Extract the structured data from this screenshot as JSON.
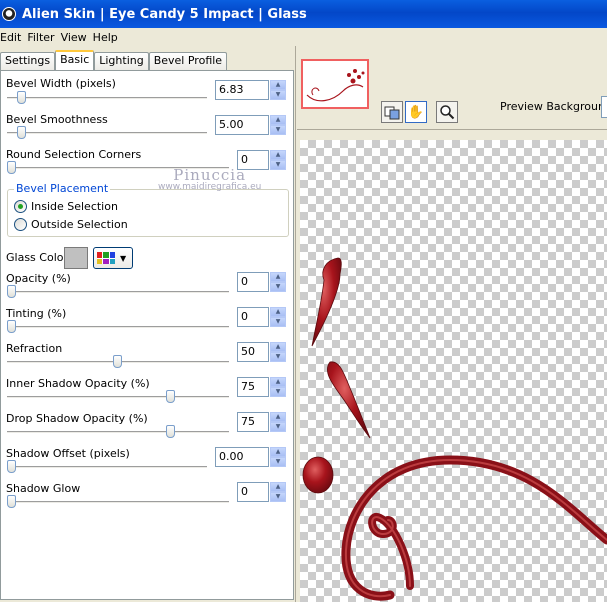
{
  "window": {
    "title": "Alien Skin | Eye Candy 5 Impact | Glass"
  },
  "menu": [
    "Edit",
    "Filter",
    "View",
    "Help"
  ],
  "tabs": [
    "Settings",
    "Basic",
    "Lighting",
    "Bevel Profile"
  ],
  "active_tab": "Basic",
  "controls": {
    "bevel_width": {
      "label": "Bevel Width (pixels)",
      "value": "6.83",
      "level": 0.05
    },
    "bevel_smoothness": {
      "label": "Bevel Smoothness",
      "value": "5.00",
      "level": 0.05
    },
    "round_corners": {
      "label": "Round Selection Corners",
      "value": "0",
      "level": 0.0
    },
    "bevel_placement": {
      "label": "Bevel Placement",
      "options": [
        "Inside Selection",
        "Outside Selection"
      ],
      "selected": "Inside Selection"
    },
    "glass_color": {
      "label": "Glass Color",
      "color": "#C0C0C0"
    },
    "opacity": {
      "label": "Opacity (%)",
      "value": "0",
      "level": 0.0
    },
    "tinting": {
      "label": "Tinting (%)",
      "value": "0",
      "level": 0.0
    },
    "refraction": {
      "label": "Refraction",
      "value": "50",
      "level": 0.5
    },
    "inner_shadow_opacity": {
      "label": "Inner Shadow Opacity (%)",
      "value": "75",
      "level": 0.75
    },
    "drop_shadow_opacity": {
      "label": "Drop Shadow Opacity (%)",
      "value": "75",
      "level": 0.75
    },
    "shadow_offset": {
      "label": "Shadow Offset (pixels)",
      "value": "0.00",
      "level": 0.0
    },
    "shadow_glow": {
      "label": "Shadow Glow",
      "value": "0",
      "level": 0.0
    }
  },
  "preview": {
    "background_label": "Preview Background:"
  },
  "watermark": {
    "name": "Pinuccia",
    "url": "www.maidiregrafica.eu"
  },
  "colors": {
    "titlebar": "#0A5FE0",
    "ornament": "#A8141C",
    "tab_highlight": "#FFC83C"
  },
  "icons": [
    "app-icon",
    "compare-icon",
    "hand-icon",
    "zoom-icon",
    "color-grid-icon",
    "dropdown-arrow-icon",
    "spin-up-icon",
    "spin-down-icon"
  ]
}
